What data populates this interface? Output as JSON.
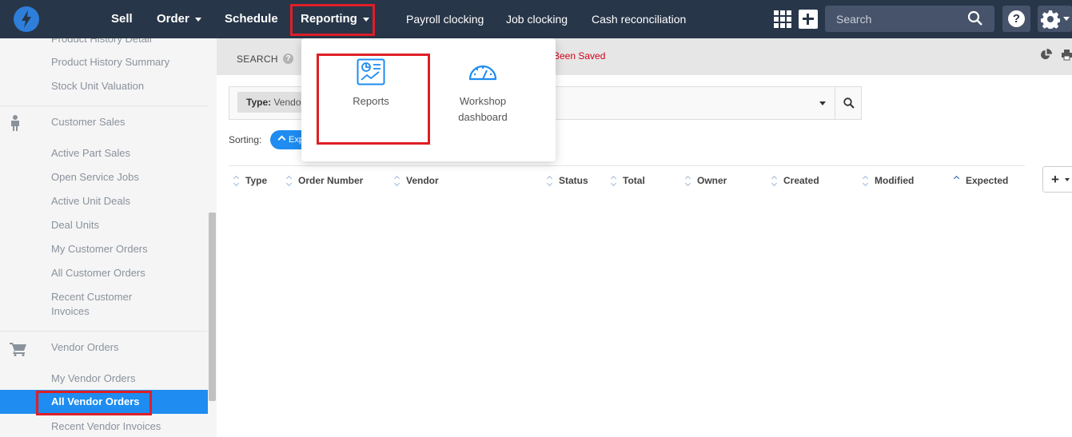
{
  "nav": {
    "sell": "Sell",
    "order": "Order",
    "schedule": "Schedule",
    "reporting": "Reporting",
    "payroll": "Payroll clocking",
    "job": "Job clocking",
    "cash": "Cash reconciliation",
    "search_placeholder": "Search",
    "help": "?"
  },
  "sidebar": {
    "top_partial": "Product History Detail",
    "items_top": [
      "Product History Summary",
      "Stock Unit Valuation"
    ],
    "customer_sales": {
      "title": "Customer Sales",
      "items": [
        "Active Part Sales",
        "Open Service Jobs",
        "Active Unit Deals",
        "Deal Units",
        "My Customer Orders",
        "All Customer Orders",
        "Recent Customer",
        "Invoices"
      ]
    },
    "vendor_orders": {
      "title": "Vendor Orders",
      "items": [
        "My Vendor Orders",
        "All Vendor Orders",
        "Recent Vendor Invoices"
      ]
    }
  },
  "subbar": {
    "label": "SEARCH",
    "help": "?",
    "saved_text": "Been Saved"
  },
  "filter": {
    "key": "Type:",
    "value": "Vendor"
  },
  "sorting": {
    "label": "Sorting:",
    "pill": "Expected"
  },
  "columns": [
    "Type",
    "Order Number",
    "Vendor",
    "Status",
    "Total",
    "Owner",
    "Created",
    "Modified",
    "Expected"
  ],
  "column_button": "+",
  "dropdown": {
    "reports": "Reports",
    "workshop_line1": "Workshop",
    "workshop_line2": "dashboard"
  },
  "colors": {
    "topbar": "#283649",
    "accent": "#1e8cf0",
    "highlight": "#e01e26",
    "saved": "#d0021b"
  }
}
